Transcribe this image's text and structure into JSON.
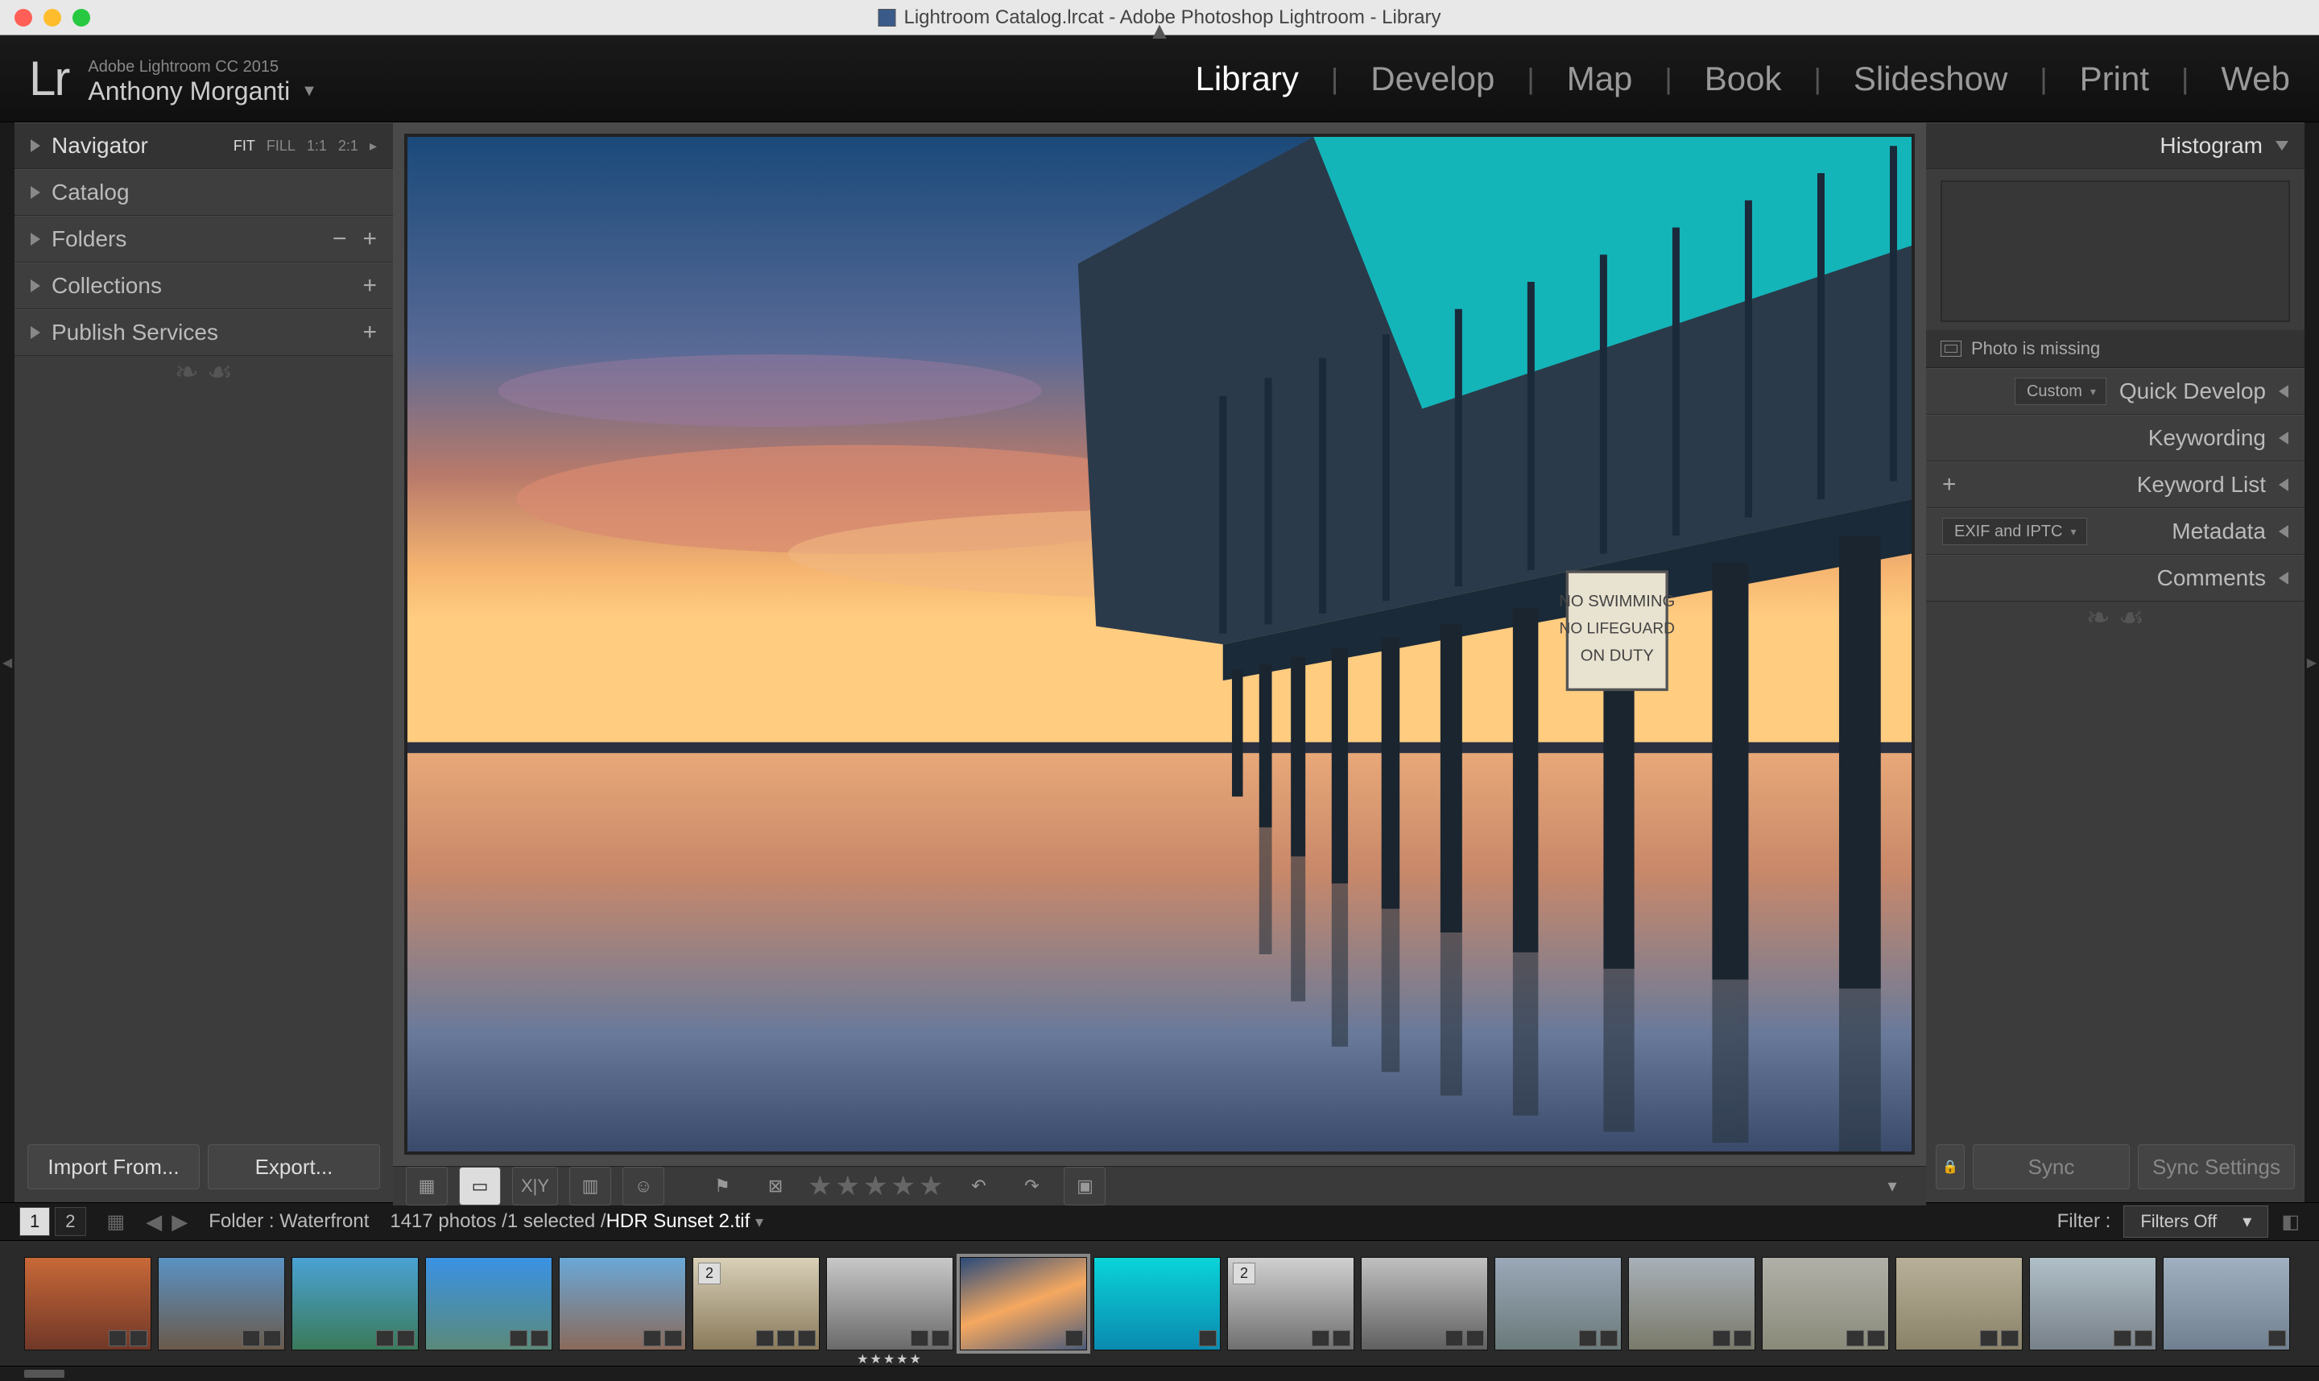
{
  "titlebar": {
    "title": "Lightroom Catalog.lrcat - Adobe Photoshop Lightroom - Library"
  },
  "brand": {
    "logo": "Lr",
    "product": "Adobe Lightroom CC 2015",
    "user": "Anthony Morganti"
  },
  "modules": [
    "Library",
    "Develop",
    "Map",
    "Book",
    "Slideshow",
    "Print",
    "Web"
  ],
  "active_module": "Library",
  "left_panel": {
    "navigator": {
      "label": "Navigator",
      "modes": [
        "FIT",
        "FILL",
        "1:1",
        "2:1"
      ],
      "active_mode": "FIT"
    },
    "catalog": "Catalog",
    "folders": "Folders",
    "collections": "Collections",
    "publish": "Publish Services",
    "import_btn": "Import From...",
    "export_btn": "Export..."
  },
  "right_panel": {
    "histogram": "Histogram",
    "missing": "Photo is missing",
    "quick_develop": "Quick Develop",
    "quick_develop_preset": "Custom",
    "keywording": "Keywording",
    "keyword_list": "Keyword List",
    "metadata": "Metadata",
    "metadata_preset": "EXIF and IPTC",
    "comments": "Comments",
    "sync": "Sync",
    "sync_settings": "Sync Settings"
  },
  "preview_sign": {
    "l1": "NO SWIMMING",
    "l2": "NO LIFEGUARD",
    "l3": "ON DUTY"
  },
  "status": {
    "folder_label": "Folder : Waterfront",
    "count": "1417 photos /1 selected /",
    "filename": "HDR Sunset 2.tif",
    "filter_label": "Filter :",
    "filter_value": "Filters Off",
    "view1": "1",
    "view2": "2"
  },
  "filmstrip": {
    "stack_counts": {
      "5": "2",
      "9": "2"
    },
    "selected_index": 7,
    "stars_index": 6
  }
}
